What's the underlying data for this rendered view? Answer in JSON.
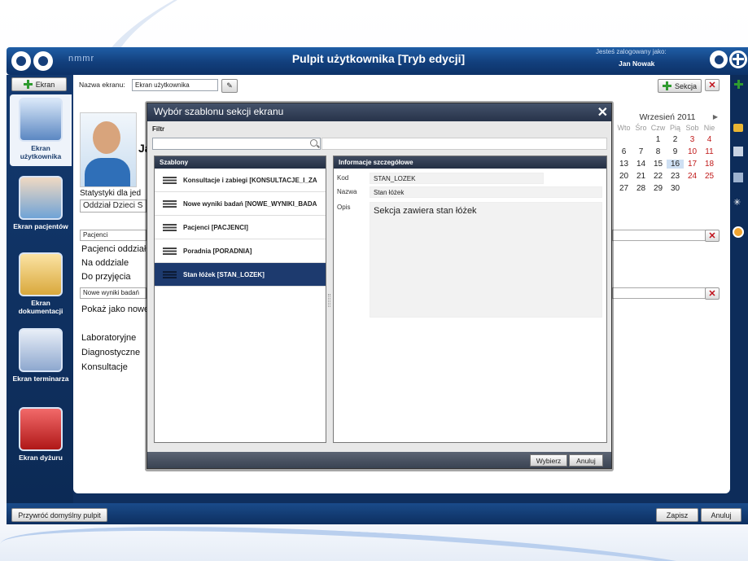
{
  "header": {
    "brand": "nmmr",
    "title": "Pulpit użytkownika [Tryb edycji]",
    "logged_in_caption": "Jesteś zalogowany jako:",
    "user_name": "Jan Nowak"
  },
  "sidebar": {
    "add_screen_label": "Ekran",
    "items": [
      {
        "label": "Ekran użytkownika",
        "icon": "monitor-icon"
      },
      {
        "label": "Ekran pacjentów",
        "icon": "patients-icon"
      },
      {
        "label": "Ekran dokumentacji",
        "icon": "folder-icon"
      },
      {
        "label": "Ekran terminarza",
        "icon": "calendar-icon"
      },
      {
        "label": "Ekran dyżuru",
        "icon": "heartbeat-icon"
      }
    ]
  },
  "screen": {
    "name_label": "Nazwa ekranu:",
    "name_value": "Ekran użytkownika",
    "add_section_label": "Sekcja"
  },
  "background": {
    "profile_name_fragment": "Ja",
    "stats_label": "Statystyki dla jed",
    "department": "Oddział Dzieci S",
    "patients_field": "Pacjenci",
    "patients_heading": "Pacjenci oddział",
    "on_ward": "Na oddziale",
    "to_admit": "Do przyjęcia",
    "new_results_field": "Nowe wyniki badań",
    "show_as_new": "Pokaż jako nowe",
    "laboratory": "Laboratoryjne",
    "diagnostic": "Diagnostyczne",
    "consultations": "Konsultacje"
  },
  "calendar": {
    "title": "Wrzesień 2011",
    "dow": [
      "Wto",
      "Śro",
      "Czw",
      "Pią",
      "Sob",
      "Nie"
    ],
    "rows": [
      [
        "",
        "",
        "1",
        "2",
        "3",
        "4"
      ],
      [
        "6",
        "7",
        "8",
        "9",
        "10",
        "11"
      ],
      [
        "13",
        "14",
        "15",
        "16",
        "17",
        "18"
      ],
      [
        "20",
        "21",
        "22",
        "23",
        "24",
        "25"
      ],
      [
        "27",
        "28",
        "29",
        "30",
        "",
        ""
      ]
    ],
    "left_column": [
      "",
      "",
      "",
      "",
      ""
    ],
    "today": "16"
  },
  "modal": {
    "title": "Wybór szablonu sekcji ekranu",
    "filter_label": "Filtr",
    "filter_value": "",
    "templates_header": "Szablony",
    "templates": [
      "Konsultacje i zabiegi [KONSULTACJE_I_ZA",
      "Nowe wyniki badań [NOWE_WYNIKI_BADA",
      "Pacjenci [PACJENCI]",
      "Poradnia [PORADNIA]",
      "Stan łóżek [STAN_LOZEK]"
    ],
    "selected_index": 4,
    "details_header": "Informacje szczegółowe",
    "code_label": "Kod",
    "code_value": "STAN_LOZEK",
    "name_label": "Nazwa",
    "name_value": "Stan łóżek",
    "desc_label": "Opis",
    "desc_value": "Sekcja zawiera stan łóżek",
    "choose_label": "Wybierz",
    "cancel_label": "Anuluj"
  },
  "footer": {
    "restore_label": "Przywróć domyślny pulpit",
    "save_label": "Zapisz",
    "cancel_label": "Anuluj"
  },
  "colors": {
    "header_blue": "#123f7c",
    "selected_item": "#1d3a6e",
    "weekend_red": "#c01a1a"
  }
}
